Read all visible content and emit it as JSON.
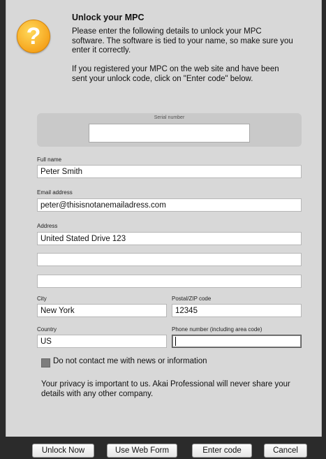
{
  "dialog": {
    "title": "Unlock your MPC",
    "intro": "Please enter the following details to unlock your MPC software. The software is tied to your name, so make sure you enter it correctly.",
    "web_note": "If you registered your MPC on the web site and have been sent your unlock code, click on \"Enter code\" below.",
    "warning_icon": "question-mark-icon",
    "warning_glyph": "?"
  },
  "serial": {
    "label": "Serial number",
    "value": ""
  },
  "form": {
    "full_name_label": "Full name",
    "full_name": "Peter Smith",
    "email_label": "Email address",
    "email": "peter@thisisnotanemailadress.com",
    "address_label": "Address",
    "address1": "United Stated Drive 123",
    "address2": "",
    "address3": "",
    "city_label": "City",
    "city": "New York",
    "postal_label": "Postal/ZIP code",
    "postal": "12345",
    "country_label": "Country",
    "country": "US",
    "phone_label": "Phone number (including area code)",
    "phone": ""
  },
  "contact_opt_out": "Do not contact me with news or information",
  "privacy": "Your privacy is important to us. Akai Professional will never share your details with any other company.",
  "buttons": {
    "unlock_now": "Unlock Now",
    "web_form": "Use Web Form",
    "enter_code": "Enter code",
    "cancel": "Cancel"
  }
}
